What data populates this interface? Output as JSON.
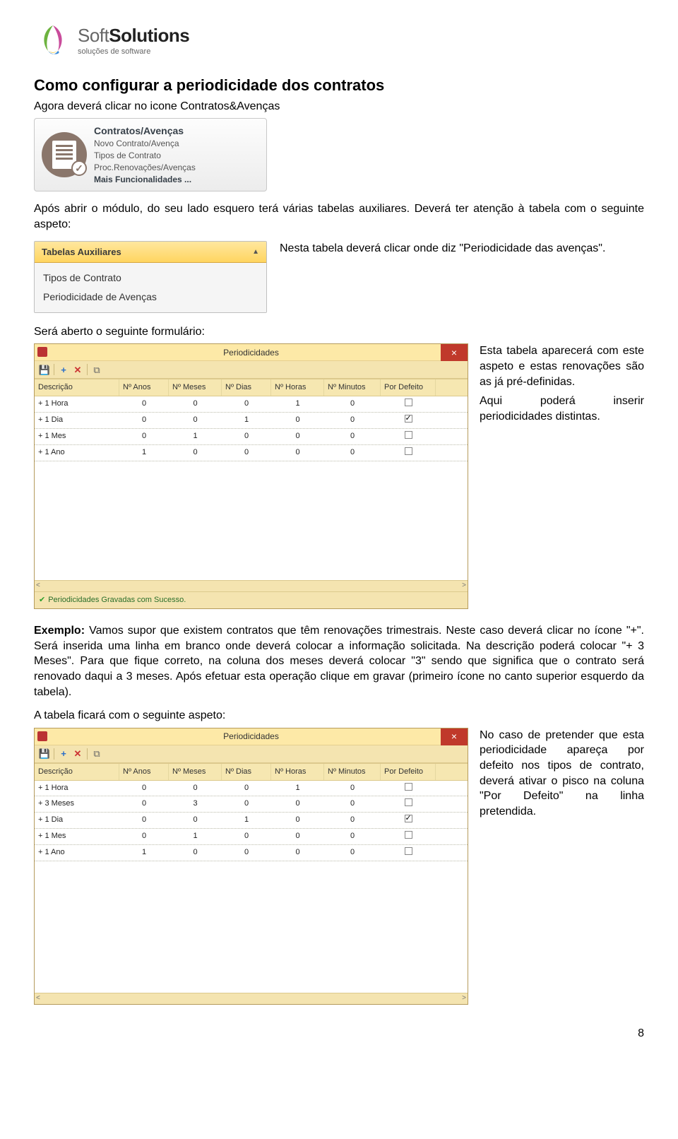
{
  "logo": {
    "soft": "Soft",
    "solutions": "Solutions",
    "tagline": "soluções de software"
  },
  "heading": "Como configurar a periodicidade dos contratos",
  "intro1": "Agora deverá clicar no icone Contratos&Avenças",
  "card": {
    "title": "Contratos/Avenças",
    "items": [
      "Novo Contrato/Avença",
      "Tipos de Contrato",
      "Proc.Renovações/Avenças"
    ],
    "more": "Mais Funcionalidades ..."
  },
  "intro2": "Após abrir o módulo, do seu lado esquero terá várias tabelas auxiliares. Deverá ter atenção à tabela com o seguinte aspeto:",
  "aux": {
    "header": "Tabelas Auxiliares",
    "items": [
      "Tipos de Contrato",
      "Periodicidade de Avenças"
    ]
  },
  "aux_side": "Nesta tabela deverá clicar onde diz \"Periodicidade das avenças\".",
  "form_intro": "Será aberto o seguinte formulário:",
  "win": {
    "title": "Periodicidades",
    "columns": [
      "Descrição",
      "Nº Anos",
      "Nº Meses",
      "Nº Dias",
      "Nº Horas",
      "Nº Minutos",
      "Por Defeito"
    ],
    "rows1": [
      {
        "d": "+ 1 Hora",
        "a": "0",
        "m": "0",
        "di": "0",
        "h": "1",
        "mi": "0",
        "def": false
      },
      {
        "d": "+ 1 Dia",
        "a": "0",
        "m": "0",
        "di": "1",
        "h": "0",
        "mi": "0",
        "def": true
      },
      {
        "d": "+ 1 Mes",
        "a": "0",
        "m": "1",
        "di": "0",
        "h": "0",
        "mi": "0",
        "def": false
      },
      {
        "d": "+ 1 Ano",
        "a": "1",
        "m": "0",
        "di": "0",
        "h": "0",
        "mi": "0",
        "def": false
      }
    ],
    "status": "Periodicidades Gravadas com Sucesso.",
    "rows2": [
      {
        "d": "+ 1 Hora",
        "a": "0",
        "m": "0",
        "di": "0",
        "h": "1",
        "mi": "0",
        "def": false
      },
      {
        "d": "+ 3 Meses",
        "a": "0",
        "m": "3",
        "di": "0",
        "h": "0",
        "mi": "0",
        "def": false
      },
      {
        "d": "+ 1 Dia",
        "a": "0",
        "m": "0",
        "di": "1",
        "h": "0",
        "mi": "0",
        "def": true
      },
      {
        "d": "+ 1 Mes",
        "a": "0",
        "m": "1",
        "di": "0",
        "h": "0",
        "mi": "0",
        "def": false
      },
      {
        "d": "+ 1 Ano",
        "a": "1",
        "m": "0",
        "di": "0",
        "h": "0",
        "mi": "0",
        "def": false
      }
    ]
  },
  "form_side": "Esta tabela aparecerá com este aspeto e estas renovações são as já pré-definidas.\nAqui poderá inserir periodicidades distintas.",
  "exemplo": "Exemplo: Vamos supor que existem contratos que têm renovações trimestrais. Neste caso deverá clicar no ícone \"+\". Será inserida uma linha em branco onde deverá colocar a informação solicitada. Na descrição poderá colocar \"+ 3 Meses\". Para que fique correto, na coluna dos meses deverá colocar \"3\" sendo que significa que o contrato será renovado daqui a 3 meses. Após efetuar esta operação clique em gravar (primeiro ícone no canto superior esquerdo da tabela).",
  "exemplo_label": "Exemplo:",
  "exemplo_rest": " Vamos supor que existem contratos que têm renovações trimestrais. Neste caso deverá clicar no ícone \"+\". Será inserida uma linha em branco onde deverá colocar a informação solicitada. Na descrição poderá colocar \"+ 3 Meses\". Para que fique correto, na coluna dos meses deverá colocar \"3\" sendo que significa que o contrato será renovado daqui a 3 meses. Após efetuar esta operação clique em gravar (primeiro ícone no canto superior esquerdo da tabela).",
  "tab2_intro": "A tabela ficará com o seguinte aspeto:",
  "tab2_side": "No caso de pretender que esta periodicidade apareça por defeito nos tipos de contrato, deverá ativar o pisco na coluna \"Por Defeito\" na linha pretendida.",
  "page_number": "8"
}
